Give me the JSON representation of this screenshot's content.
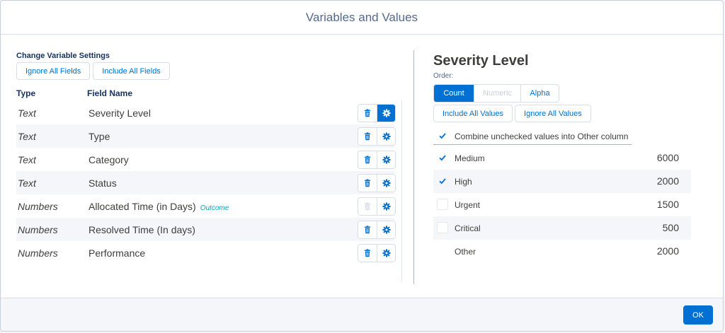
{
  "modal": {
    "title": "Variables and Values"
  },
  "left": {
    "section_label": "Change Variable Settings",
    "ignore_all_fields": "Ignore All Fields",
    "include_all_fields": "Include All Fields",
    "headers": {
      "type": "Type",
      "field_name": "Field Name"
    },
    "rows": [
      {
        "type": "Text",
        "field": "Severity Level",
        "badge": "",
        "delete_enabled": true,
        "settings_active": true
      },
      {
        "type": "Text",
        "field": "Type",
        "badge": "",
        "delete_enabled": true,
        "settings_active": false
      },
      {
        "type": "Text",
        "field": "Category",
        "badge": "",
        "delete_enabled": true,
        "settings_active": false
      },
      {
        "type": "Text",
        "field": "Status",
        "badge": "",
        "delete_enabled": true,
        "settings_active": false
      },
      {
        "type": "Numbers",
        "field": "Allocated Time (in Days)",
        "badge": "Outcome",
        "delete_enabled": false,
        "settings_active": false
      },
      {
        "type": "Numbers",
        "field": "Resolved Time (In days)",
        "badge": "",
        "delete_enabled": true,
        "settings_active": false
      },
      {
        "type": "Numbers",
        "field": "Performance",
        "badge": "",
        "delete_enabled": true,
        "settings_active": false
      }
    ]
  },
  "right": {
    "title": "Severity Level",
    "order_label": "Order:",
    "order_options": [
      {
        "label": "Count",
        "state": "active"
      },
      {
        "label": "Numeric",
        "state": "disabled"
      },
      {
        "label": "Alpha",
        "state": "normal"
      }
    ],
    "include_all_values": "Include All Values",
    "ignore_all_values": "Ignore All Values",
    "combine_label": "Combine unchecked values into Other column",
    "combine_checked": true,
    "values": [
      {
        "name": "Medium",
        "count": "6000",
        "checked": true,
        "checkbox": true
      },
      {
        "name": "High",
        "count": "2000",
        "checked": true,
        "checkbox": true
      },
      {
        "name": "Urgent",
        "count": "1500",
        "checked": false,
        "checkbox": true
      },
      {
        "name": "Critical",
        "count": "500",
        "checked": false,
        "checkbox": true
      },
      {
        "name": "Other",
        "count": "2000",
        "checked": false,
        "checkbox": false
      }
    ]
  },
  "footer": {
    "ok_label": "OK"
  },
  "icons": {
    "delete": "trash-icon",
    "settings": "gear-icon",
    "check": "checkmark-icon"
  },
  "colors": {
    "brand": "#0070d2",
    "text": "#3e3e3c",
    "badge": "#04a7b7",
    "alt_row": "#f4f6f9"
  }
}
